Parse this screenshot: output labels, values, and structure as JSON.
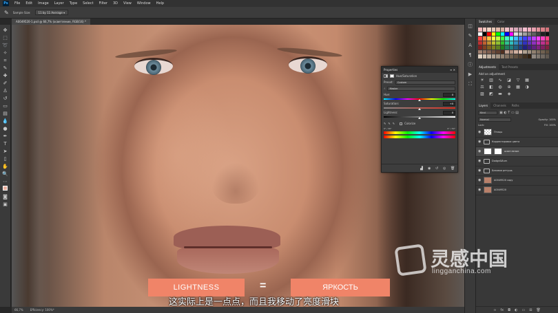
{
  "menubar": {
    "items": [
      "File",
      "Edit",
      "Image",
      "Layer",
      "Type",
      "Select",
      "Filter",
      "3D",
      "View",
      "Window",
      "Help"
    ]
  },
  "options": {
    "sample_size_label": "Sample Size:",
    "sample_size_value": "11 by 11 Average"
  },
  "document": {
    "tab_title": "A0049520-1.psd @ 66,7% (осветление, RGB/16) *",
    "zoom": "66,7%",
    "efficiency": "Efficiency: 100%*"
  },
  "properties": {
    "panel_title": "Properties",
    "adjustment_name": "Hue/Saturation",
    "preset_label": "Preset:",
    "preset_value": "Custom",
    "channel_value": "Master",
    "hue_label": "Hue:",
    "hue_value": "0",
    "saturation_label": "Saturation:",
    "saturation_value": "+0",
    "lightness_label": "Lightness:",
    "lightness_value": "0",
    "colorize_label": "Colorize",
    "range_left": "0° / 30°",
    "range_right": "0° / 30°",
    "hue_fraction": 0.5,
    "saturation_fraction": 0.5,
    "lightness_fraction": 0.5
  },
  "right_panels": {
    "swatches_tab": "Swatches",
    "color_tab": "Color",
    "adjustments_tab": "Adjustments",
    "text_presets_tab": "Text Presets",
    "add_adjustment_label": "Add an adjustment",
    "layers_tab": "Layers",
    "channels_tab": "Channels",
    "paths_tab": "Paths",
    "kind_label": "Kind",
    "blend_mode": "Normal",
    "opacity_label": "Opacity: 100%",
    "lock_label": "Lock:",
    "fill_label": "Fill: 100%",
    "layers": [
      {
        "name": "Птицы",
        "type": "pixel",
        "selected": false
      },
      {
        "name": "Корректировка цвета",
        "type": "group",
        "selected": false
      },
      {
        "name": "осветление",
        "type": "adjustment",
        "selected": true
      },
      {
        "name": "Dodge&Burn",
        "type": "group",
        "selected": false
      },
      {
        "name": "Базовая ретушь",
        "type": "group",
        "selected": false
      },
      {
        "name": "A0049520 copy",
        "type": "pixel",
        "selected": false
      },
      {
        "name": "A0049520",
        "type": "pixel",
        "selected": false
      }
    ]
  },
  "subtitles": {
    "english_word": "LIGHTNESS",
    "equals": "=",
    "russian_word": "ЯРКОСТЬ",
    "chinese_line": "这实际上是一点点，而且我移动了亮度滑块"
  },
  "watermark": {
    "brand": "灵感中国",
    "url": "lingganchina.com"
  },
  "colors": {
    "subtitle_bg": "#f08468",
    "panel_bg": "#383838",
    "canvas_bg": "#535353"
  }
}
